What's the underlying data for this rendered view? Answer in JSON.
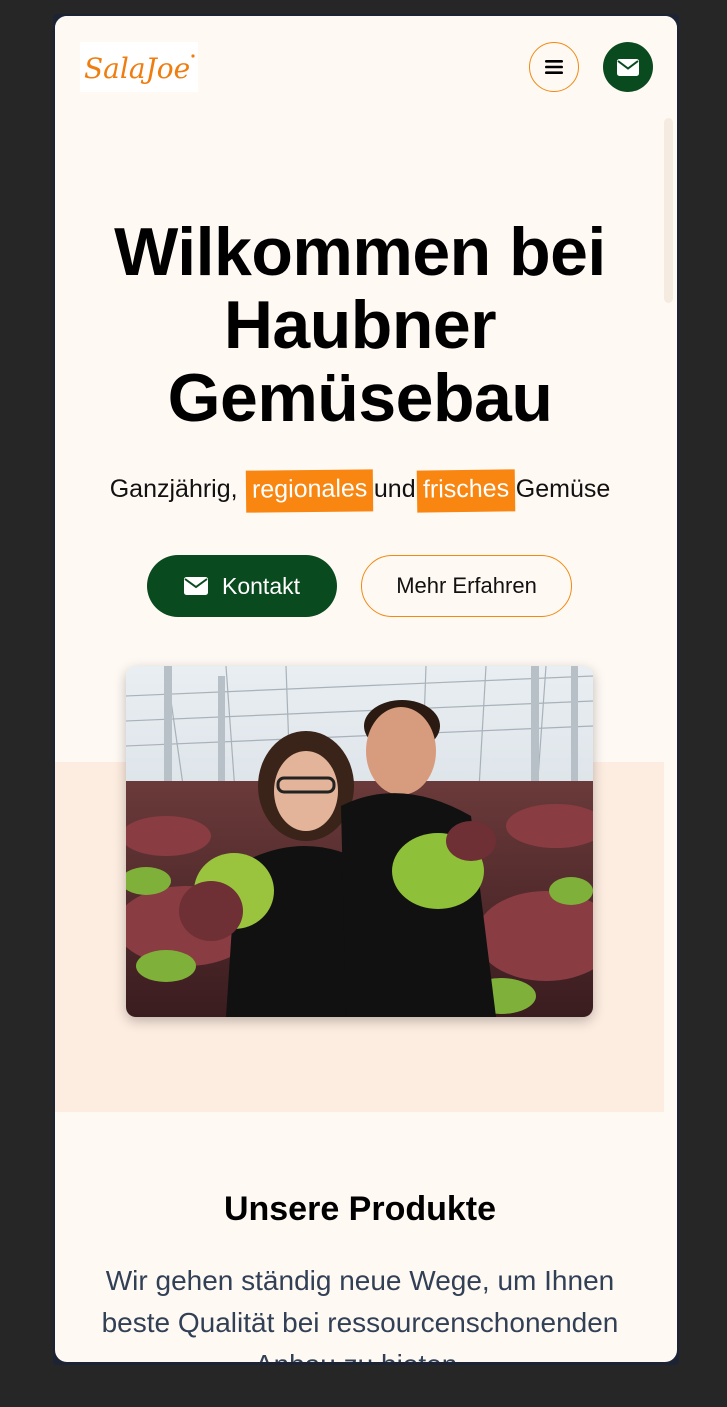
{
  "header": {
    "logo_text": "SalaJoe",
    "menu_icon": "hamburger-icon",
    "mail_icon": "envelope-icon"
  },
  "hero": {
    "title": "Wilkommen bei Haubner Gemüsebau",
    "tagline": {
      "part1": "Ganzjährig,",
      "highlight1": "regionales",
      "part2": "und",
      "highlight2": "frisches",
      "part3": "Gemüse"
    },
    "buttons": {
      "contact_label": "Kontakt",
      "more_label": "Mehr Erfahren"
    }
  },
  "products": {
    "title": "Unsere Produkte",
    "text": "Wir gehen ständig neue Wege, um Ihnen beste Qualität bei ressourcenschonenden Anbau zu bieten."
  },
  "colors": {
    "accent_orange": "#f88610",
    "dark_green": "#0a4a1f",
    "background": "#fff9f4",
    "peach": "#fdece0"
  }
}
